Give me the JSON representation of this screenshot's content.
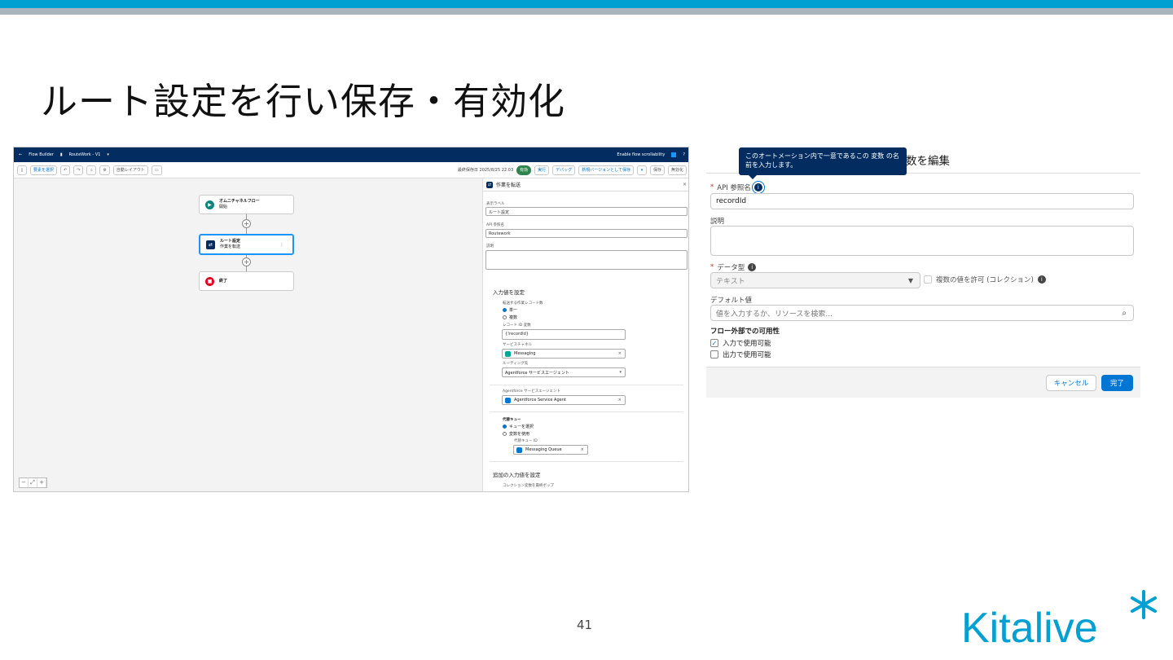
{
  "slide": {
    "title": "ルート設定を行い保存・有効化",
    "page_number": "41",
    "logo_text": "Kitalive"
  },
  "flow_builder": {
    "topbar": {
      "back_icon": "←",
      "app_name": "Flow Builder",
      "flow_name": "RouteWork - V1",
      "scroll_label": "Enable flow scrollability",
      "help_icon": "?"
    },
    "toolbar": {
      "select_elements": "要素を選択",
      "layout_select": "自動レイアウト",
      "last_saved": "最終保存日 2025/8/25 22:03",
      "active_badge": "有効",
      "run_label": "実行",
      "debug_label": "デバッグ",
      "save_as_label": "新規バージョンとして保存",
      "activate_label": "保存",
      "deactivate_label": "無効化"
    },
    "nodes": [
      {
        "title": "オムニチャネルフロー",
        "subtitle": "開始"
      },
      {
        "title": "ルート設定",
        "subtitle": "作業を転送"
      },
      {
        "title": "終了",
        "subtitle": ""
      }
    ],
    "panel": {
      "header": "作業を転送",
      "label_field": "表示ラベル",
      "label_value": "ルート設定",
      "api_field": "API 参照名",
      "api_value": "Routework",
      "desc_field": "説明",
      "section_inputs": "入力値を設定",
      "record_count_label": "転送する作業レコード数",
      "radio_single": "単一",
      "radio_multiple": "複数",
      "record_id_label": "レコード ID 変数",
      "record_id_value": "{!recordId}",
      "service_channel_label": "サービスチャネル",
      "service_channel_value": "Messaging",
      "routing_label": "ルーティング先",
      "routing_value": "Agentforce サービスエージェント",
      "agent_label": "Agentforce サービスエージェント",
      "agent_value": "Agentforce Service Agent",
      "fallback_label": "代替キュー",
      "fallback_radio_queue": "キューを選択",
      "fallback_radio_var": "変数を使用",
      "fallback_id_label": "代替キュー ID",
      "fallback_id_value": "Messaging Queue",
      "section_additional": "追加の入力値を設定",
      "collection_label": "コレクション変数を最終ポップ"
    }
  },
  "editor": {
    "title": "数を編集",
    "tooltip": "このオートメーション内で一意であるこの 変数 の名前を入力します。",
    "api_label": "API 参照名",
    "api_value": "recordId",
    "desc_label": "説明",
    "datatype_label": "データ型",
    "datatype_value": "テキスト",
    "allow_multiple": "複数の値を許可 (コレクション)",
    "default_label": "デフォルト値",
    "default_placeholder": "値を入力するか、リソースを検索...",
    "availability_heading": "フロー外部での可用性",
    "available_input": "入力で使用可能",
    "available_output": "出力で使用可能",
    "cancel_label": "キャンセル",
    "done_label": "完了"
  },
  "colors": {
    "stripe_blue": "#00a0d2",
    "stripe_gray": "#aab4bc",
    "navy": "#032d60",
    "brand_blue": "#0176d3",
    "active_green": "#2e844a",
    "start_teal": "#0b827c",
    "end_red": "#ea001e"
  }
}
